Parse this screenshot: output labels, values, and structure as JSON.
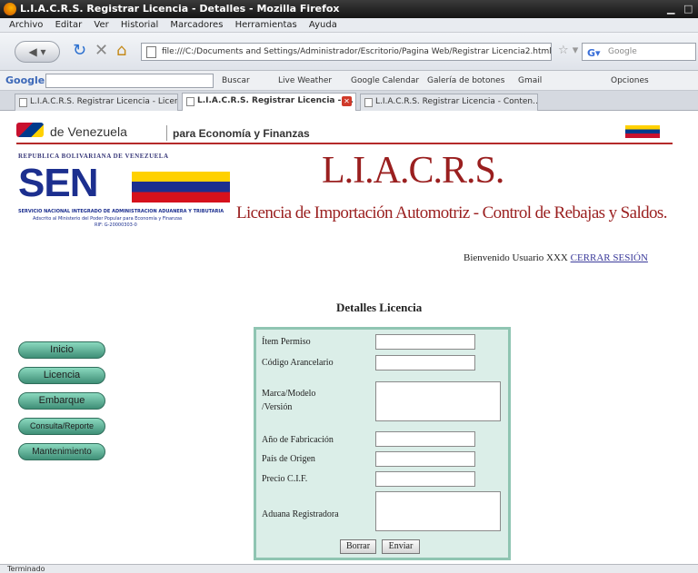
{
  "window": {
    "title": "L.I.A.C.R.S. Registrar Licencia - Detalles - Mozilla Firefox"
  },
  "menu": [
    "Archivo",
    "Editar",
    "Ver",
    "Historial",
    "Marcadores",
    "Herramientas",
    "Ayuda"
  ],
  "nav": {
    "url": "file:///C:/Documents and Settings/Administrador/Escritorio/Pagina Web/Registrar Licencia2.html",
    "search_placeholder": "Google"
  },
  "google_toolbar": {
    "logo": "Google",
    "items": [
      "Buscar",
      "Live Weather",
      "Google Calendar",
      "Galería de botones",
      "Gmail",
      "Opciones"
    ]
  },
  "tabs": [
    {
      "label": "L.I.A.C.R.S. Registrar Licencia - Licencia"
    },
    {
      "label": "L.I.A.C.R.S. Registrar Licencia - ..."
    },
    {
      "label": "L.I.A.C.R.S. Registrar Licencia - Conten..."
    }
  ],
  "gov": {
    "left": "de Venezuela",
    "right": "para Economía y Finanzas"
  },
  "seniat": {
    "top": "REPUBLICA BOLIVARIANA DE VENEZUELA",
    "logo": "SEN",
    "sub1": "SERVICIO NACIONAL INTEGRADO DE ADMINISTRACION ADUANERA Y TRIBUTARIA",
    "sub2": "Adscrito al Ministerio del Poder Popular para Economía y Finanzas",
    "sub3": "RIF: G-20000303-0"
  },
  "app": {
    "title": "L.I.A.C.R.S.",
    "subtitle": "Licencia de Importación Automotriz - Control de Rebajas y Saldos."
  },
  "user": {
    "welcome": "Bienvenido Usuario XXX",
    "logout": "CERRAR SESIÓN"
  },
  "section_title": "Detalles Licencia",
  "sidenav": [
    "Inicio",
    "Licencia",
    "Embarque",
    "Consulta/Reporte",
    "Mantenimiento"
  ],
  "form": {
    "fields": [
      "Ítem Permiso",
      "Código Arancelario",
      "Marca/Modelo",
      "/Versión",
      "Año de Fabricación",
      "País de Origen",
      "Precio C.I.F.",
      "Aduana Registradora"
    ],
    "buttons": {
      "clear": "Borrar",
      "submit": "Enviar"
    }
  },
  "status": "Terminado"
}
